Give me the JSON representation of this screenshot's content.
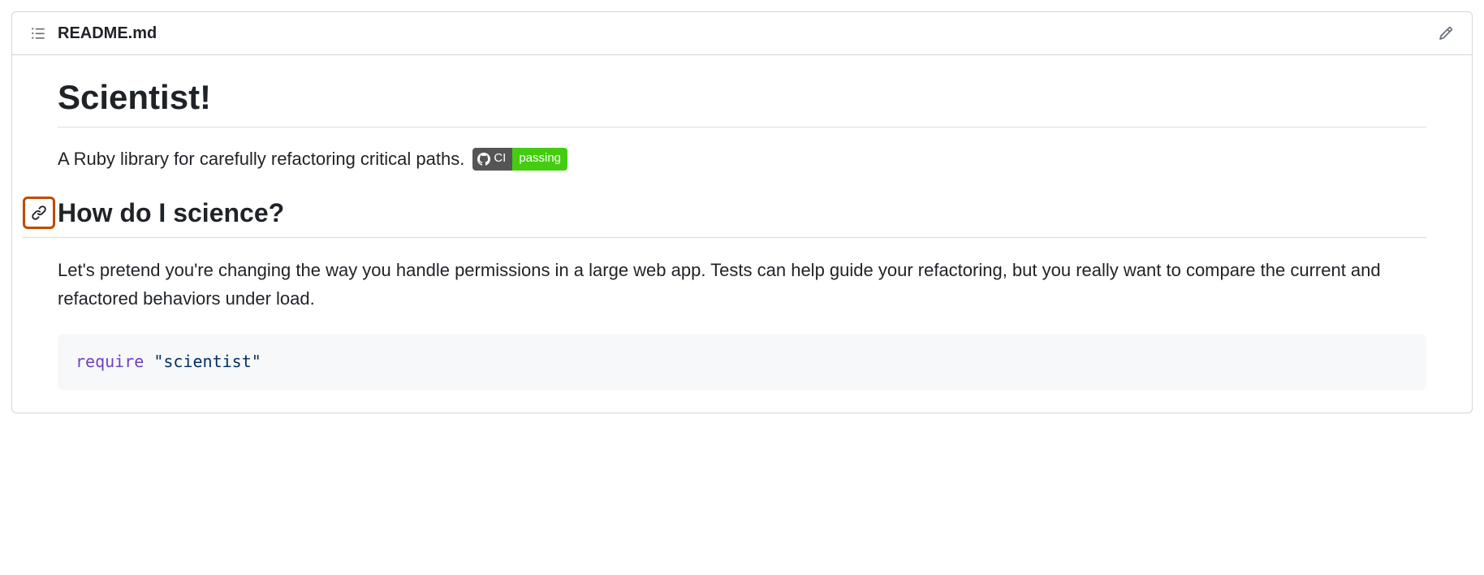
{
  "header": {
    "filename": "README.md"
  },
  "content": {
    "title": "Scientist!",
    "description": "A Ruby library for carefully refactoring critical paths.",
    "badge": {
      "left": "CI",
      "right": "passing"
    },
    "heading2": "How do I science?",
    "paragraph": "Let's pretend you're changing the way you handle permissions in a large web app. Tests can help guide your refactoring, but you really want to compare the current and refactored behaviors under load.",
    "code": {
      "keyword": "require",
      "string": "\"scientist\""
    }
  }
}
